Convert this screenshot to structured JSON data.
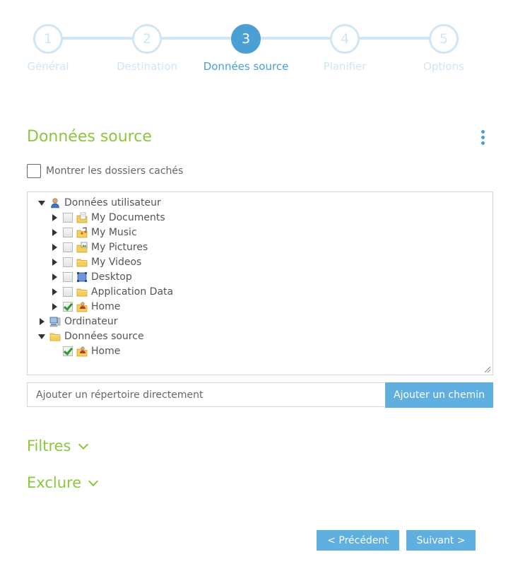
{
  "stepper": {
    "steps": [
      {
        "number": "1",
        "label": "Général"
      },
      {
        "number": "2",
        "label": "Destination"
      },
      {
        "number": "3",
        "label": "Données source"
      },
      {
        "number": "4",
        "label": "Planifier"
      },
      {
        "number": "5",
        "label": "Options"
      }
    ],
    "active_index": 2
  },
  "section": {
    "title": "Données source",
    "menu_icon": "more-vertical-icon",
    "show_hidden_label": "Montrer les dossiers cachés",
    "show_hidden_checked": false
  },
  "tree": {
    "items": [
      {
        "label": "Données utilisateur",
        "icon": "user-icon"
      },
      {
        "label": "My Documents",
        "icon": "documents-folder-icon",
        "checked": false
      },
      {
        "label": "My Music",
        "icon": "music-folder-icon",
        "checked": false
      },
      {
        "label": "My Pictures",
        "icon": "pictures-folder-icon",
        "checked": false
      },
      {
        "label": "My Videos",
        "icon": "folder-icon",
        "checked": false
      },
      {
        "label": "Desktop",
        "icon": "desktop-icon",
        "checked": false
      },
      {
        "label": "Application Data",
        "icon": "folder-icon",
        "checked": false
      },
      {
        "label": "Home",
        "icon": "home-folder-icon",
        "checked": true
      },
      {
        "label": "Ordinateur",
        "icon": "computer-icon"
      },
      {
        "label": "Données source",
        "icon": "folder-icon"
      },
      {
        "label": "Home",
        "icon": "home-folder-icon",
        "checked": true
      }
    ]
  },
  "path": {
    "placeholder": "Ajouter un répertoire directement",
    "value": "",
    "button_label": "Ajouter un chemin"
  },
  "filters": {
    "label": "Filtres",
    "icon": "chevron-down-icon"
  },
  "exclude": {
    "label": "Exclure",
    "icon": "chevron-down-icon"
  },
  "footer": {
    "previous_label": "< Précédent",
    "next_label": "Suivant >"
  },
  "colors": {
    "accent_blue": "#4aa0d5",
    "button_blue": "#5fb0e0",
    "inactive_step": "#cfe6f6",
    "heading_green": "#8cc63f"
  }
}
